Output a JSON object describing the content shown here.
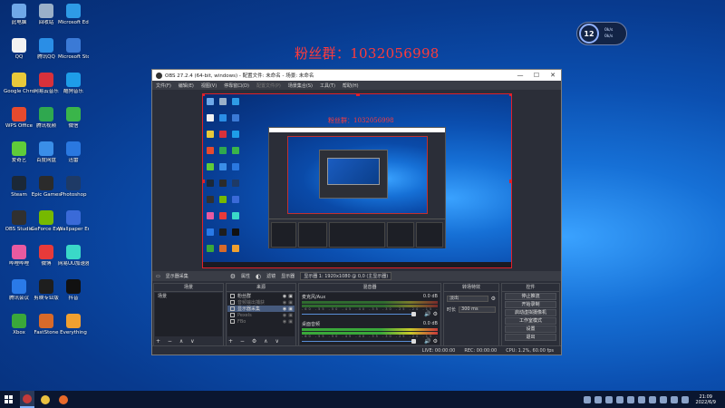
{
  "desktop": {
    "fan_group_text": "粉丝群：1032056998",
    "icons": [
      {
        "label": "此电脑",
        "color": "#6fa8e8"
      },
      {
        "label": "回收站",
        "color": "#9ab0c8"
      },
      {
        "label": "Microsoft Edge",
        "color": "#2e9be6"
      },
      {
        "label": "QQ",
        "color": "#f2f2f2"
      },
      {
        "label": "腾讯QQ",
        "color": "#2a8ee6"
      },
      {
        "label": "Microsoft Store",
        "color": "#3b7ad6"
      },
      {
        "label": "Google Chrome",
        "color": "#e8c93a"
      },
      {
        "label": "网易云音乐",
        "color": "#d8313b"
      },
      {
        "label": "酷狗音乐",
        "color": "#1e9de8"
      },
      {
        "label": "WPS Office",
        "color": "#e64a2e"
      },
      {
        "label": "腾讯视频",
        "color": "#2fa84f"
      },
      {
        "label": "微信",
        "color": "#3ab54a"
      },
      {
        "label": "爱奇艺",
        "color": "#5fcc3a"
      },
      {
        "label": "百度网盘",
        "color": "#3a8ee8"
      },
      {
        "label": "迅雷",
        "color": "#2a78e0"
      },
      {
        "label": "Steam",
        "color": "#1b2838"
      },
      {
        "label": "Epic Games",
        "color": "#2b2b2b"
      },
      {
        "label": "Photoshop",
        "color": "#1e3a66"
      },
      {
        "label": "OBS Studio",
        "color": "#303030"
      },
      {
        "label": "GeForce Experience",
        "color": "#76b900"
      },
      {
        "label": "Wallpaper Engine",
        "color": "#3a6ad8"
      },
      {
        "label": "哔哩哔哩",
        "color": "#e85aa0"
      },
      {
        "label": "微博",
        "color": "#e83a3a"
      },
      {
        "label": "网易UU加速器",
        "color": "#3ad8c8"
      },
      {
        "label": "腾讯会议",
        "color": "#2a7ae8"
      },
      {
        "label": "剪映专业版",
        "color": "#1e1e1e"
      },
      {
        "label": "抖音",
        "color": "#111111"
      },
      {
        "label": "Xbox",
        "color": "#3aa83a"
      },
      {
        "label": "FastStone",
        "color": "#d86a2a"
      },
      {
        "label": "Everything",
        "color": "#f0a030"
      }
    ]
  },
  "widget": {
    "value": "12",
    "stats_line1": "0k/s",
    "stats_line2": "0k/s"
  },
  "obs": {
    "title": "OBS 27.2.4 (64-bit, windows) - 配置文件: 未命名 - 场景: 未命名",
    "window_controls": [
      "—",
      "☐",
      "✕"
    ],
    "menu": [
      "文件(F)",
      "编辑(E)",
      "视图(V)",
      "停靠窗口(D)",
      "配置文件(P)",
      "场景集合(S)",
      "工具(T)",
      "帮助(H)"
    ],
    "menu_disabled_index": 4,
    "scene_bar": {
      "source_label": "显示器采集",
      "properties": "属性",
      "filters": "滤镜",
      "display_label": "显示器",
      "display_value": "显示器 1: 1920x1080 @ 0,0 (主显示器)"
    },
    "docks": {
      "scenes": {
        "title": "场景",
        "items": [
          "场景"
        ]
      },
      "sources": {
        "title": "来源",
        "items": [
          {
            "label": "粉丝群",
            "icon": "text-icon",
            "dim": false
          },
          {
            "label": "音频输出捕获",
            "icon": "speaker-icon",
            "dim": true
          },
          {
            "label": "显示器采集",
            "icon": "monitor-icon",
            "dim": false
          },
          {
            "label": "Pexels",
            "icon": "image-icon",
            "dim": true
          },
          {
            "label": "FBo",
            "icon": "image-icon",
            "dim": true
          }
        ]
      },
      "mixer": {
        "title": "混音器",
        "channels": [
          {
            "name": "麦克风/Aux",
            "db": "0.0 dB"
          },
          {
            "name": "桌面音频",
            "db": "0.0 dB"
          }
        ],
        "ticks": "-60 -55 -50 -45 -40 -35 -30 -25 -20 -15 -10 -5 0"
      },
      "transitions": {
        "title": "转场特效",
        "selected": "淡出",
        "duration_label": "时长",
        "duration_value": "300 ms"
      },
      "controls": {
        "title": "控件",
        "buttons": [
          "停止推流",
          "开始录制",
          "启动虚拟摄像机",
          "工作室模式",
          "设置",
          "退出"
        ]
      }
    },
    "status": {
      "live": "LIVE: 00:00:00",
      "rec": "REC: 00:00:00",
      "cpu": "CPU: 1.2%, 60.00 fps"
    }
  },
  "preview_fan_text": "粉丝群：1032056998",
  "taskbar": {
    "time": "21:09",
    "date": "2022/6/9",
    "apps": [
      {
        "name": "obs",
        "color": "#c33a3a",
        "active": true
      },
      {
        "name": "file-explorer",
        "color": "#e8c040",
        "active": false
      },
      {
        "name": "chrome",
        "color": "#e86a2a",
        "active": false
      }
    ]
  }
}
